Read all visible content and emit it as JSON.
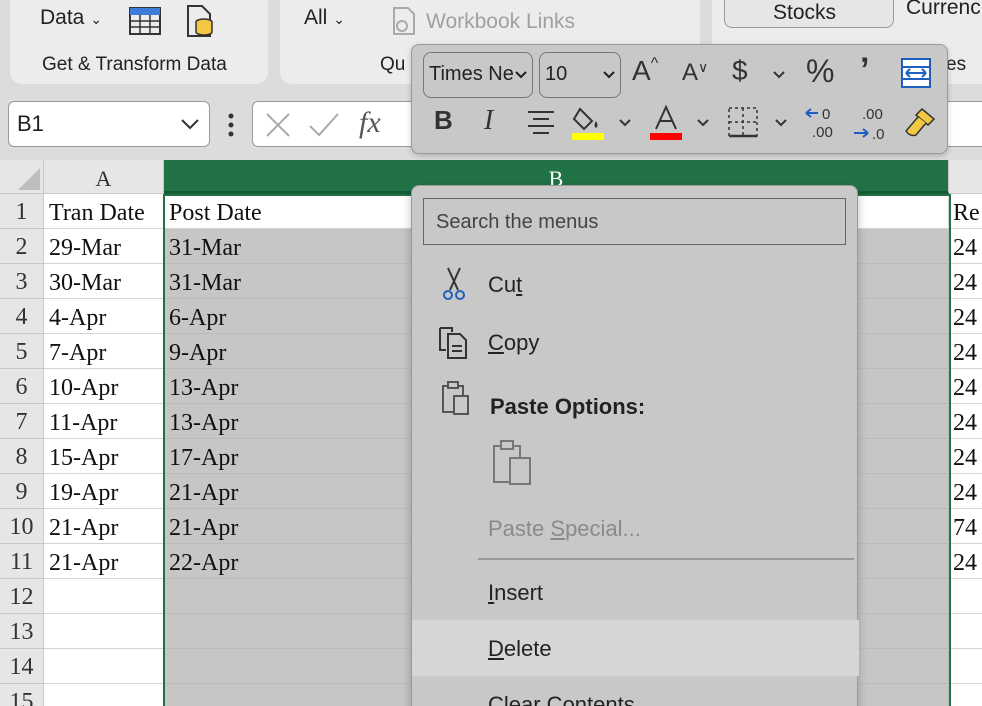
{
  "ribbon": {
    "data_label": "Data",
    "group_get_transform": "Get & Transform Data",
    "all_label": "All",
    "workbook_links": "Workbook Links",
    "queries_truncated": "Qu",
    "stocks": "Stocks",
    "currencies_truncated": "Currenc",
    "datatypes_truncated": "es"
  },
  "formula_bar": {
    "name_box": "B1",
    "fx_label": "fx"
  },
  "mini_toolbar": {
    "font_name": "Times Ne",
    "font_size": "10",
    "icons": [
      "increase-font-icon",
      "decrease-font-icon",
      "currency-icon",
      "percent-icon",
      "comma-icon",
      "merge-center-icon",
      "bold-icon",
      "italic-icon",
      "center-align-icon",
      "fill-color-icon",
      "font-color-icon",
      "borders-icon",
      "increase-decimal-icon",
      "decrease-decimal-icon",
      "format-painter-icon"
    ],
    "colors": {
      "fill_bar": "#ffff00",
      "font_bar": "#ff0000"
    }
  },
  "grid": {
    "columns": [
      "A",
      "B"
    ],
    "rows": [
      "1",
      "2",
      "3",
      "4",
      "5",
      "6",
      "7",
      "8",
      "9",
      "10",
      "11",
      "12",
      "13",
      "14",
      "15"
    ],
    "col_a": [
      "Tran Date",
      "29-Mar",
      "30-Mar",
      "4-Apr",
      "7-Apr",
      "10-Apr",
      "11-Apr",
      "15-Apr",
      "19-Apr",
      "21-Apr",
      "21-Apr"
    ],
    "col_b": [
      "Post Date",
      "31-Mar",
      "31-Mar",
      "6-Apr",
      "9-Apr",
      "13-Apr",
      "13-Apr",
      "17-Apr",
      "21-Apr",
      "21-Apr",
      "22-Apr"
    ],
    "col_right": [
      "Re",
      "24",
      "24",
      "24",
      "24",
      "24",
      "24",
      "24",
      "24",
      "74",
      "24"
    ],
    "accent": "#217346"
  },
  "context_menu": {
    "search_placeholder": "Search the menus",
    "items": [
      {
        "label": "Cut"
      },
      {
        "label": "Copy"
      },
      {
        "label": "Paste Options:"
      },
      {
        "label": "Paste Special..."
      },
      {
        "label": "Insert"
      },
      {
        "label": "Delete"
      },
      {
        "label": "Clear Contents"
      }
    ]
  }
}
